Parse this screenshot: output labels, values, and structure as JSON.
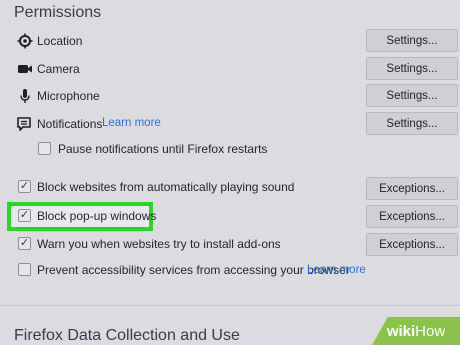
{
  "permissions": {
    "title": "Permissions",
    "location": {
      "label": "Location",
      "button": "Settings..."
    },
    "camera": {
      "label": "Camera",
      "button": "Settings..."
    },
    "microphone": {
      "label": "Microphone",
      "button": "Settings..."
    },
    "notifications": {
      "label": "Notifications",
      "link": "Learn more",
      "button": "Settings..."
    },
    "pause_notifications": {
      "label": "Pause notifications until Firefox restarts",
      "checked": false
    },
    "block_autoplay": {
      "label": "Block websites from automatically playing sound",
      "checked": true,
      "button": "Exceptions..."
    },
    "block_popups": {
      "label": "Block pop-up windows",
      "checked": true,
      "button": "Exceptions..."
    },
    "warn_addons": {
      "label": "Warn you when websites try to install add-ons",
      "checked": true,
      "button": "Exceptions..."
    },
    "prevent_accessibility": {
      "label": "Prevent accessibility services from accessing your browser",
      "link": "Learn more",
      "checked": false
    }
  },
  "data_collection": {
    "title": "Firefox Data Collection and Use"
  },
  "watermark": {
    "wiki": "wiki",
    "how": "How"
  },
  "colors": {
    "highlight": "#29d529",
    "link": "#2a6fd6",
    "watermark": "#8bc34a"
  },
  "icons": [
    "location-icon",
    "camera-icon",
    "microphone-icon",
    "notifications-icon",
    "checkmark-icon"
  ]
}
